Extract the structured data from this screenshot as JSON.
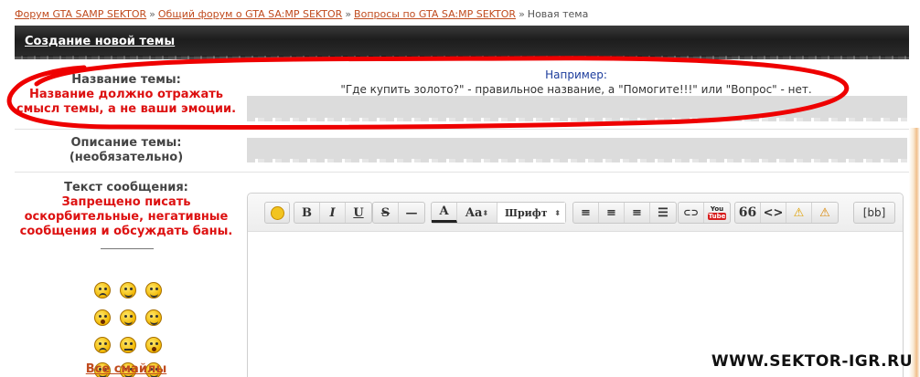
{
  "breadcrumb": {
    "items": [
      "Форум GTA SAMP SEKTOR",
      "Общий форум о GTA SA:MP SEKTOR",
      "Вопросы по GTA SA:MP SEKTOR"
    ],
    "current": "Новая тема",
    "separator": "»"
  },
  "header": {
    "title": "Создание новой темы"
  },
  "topic_title": {
    "label": "Название темы:",
    "warning_line1": "Название должно отражать",
    "warning_line2": "смысл темы, а не ваши эмоции.",
    "hint_title": "Например:",
    "hint_text": "\"Где купить золото?\" - правильное название, а \"Помогите!!!\" или \"Вопрос\" - нет.",
    "value": ""
  },
  "topic_description": {
    "label_line1": "Описание темы:",
    "label_line2": "(необязательно)",
    "value": ""
  },
  "message": {
    "label": "Текст сообщения:",
    "warning_line1": "Запрещено писать",
    "warning_line2": "оскорбительные, негативные",
    "warning_line3": "сообщения и обсуждать баны.",
    "value": ""
  },
  "toolbar": {
    "bold": "B",
    "italic": "I",
    "underline": "U",
    "strike": "S",
    "hr": "—",
    "font_color": "A",
    "font_size": "Aa",
    "font_family": "Шрифт",
    "link": "⊂⊃",
    "youtube_top": "You",
    "youtube_bottom": "Tube",
    "quote": "66",
    "code": "<>",
    "bb": "[bb]"
  },
  "smileys": {
    "all_link": "Все смайлы",
    "icons": [
      "angry-smiley",
      "grin-smiley",
      "cool-smiley",
      "shocked-smiley",
      "smile-smiley",
      "happy-smiley",
      "sad-smiley",
      "neutral-smiley",
      "surprised-smiley",
      "tongue-smiley",
      "laugh-smiley",
      "wink-smiley"
    ]
  },
  "watermark": "WWW.SEKTOR-IGR.RU",
  "colors": {
    "link": "#c04b1e",
    "warning": "#dd1111",
    "hint": "#1c3c9c",
    "annotation": "#ee0000"
  }
}
